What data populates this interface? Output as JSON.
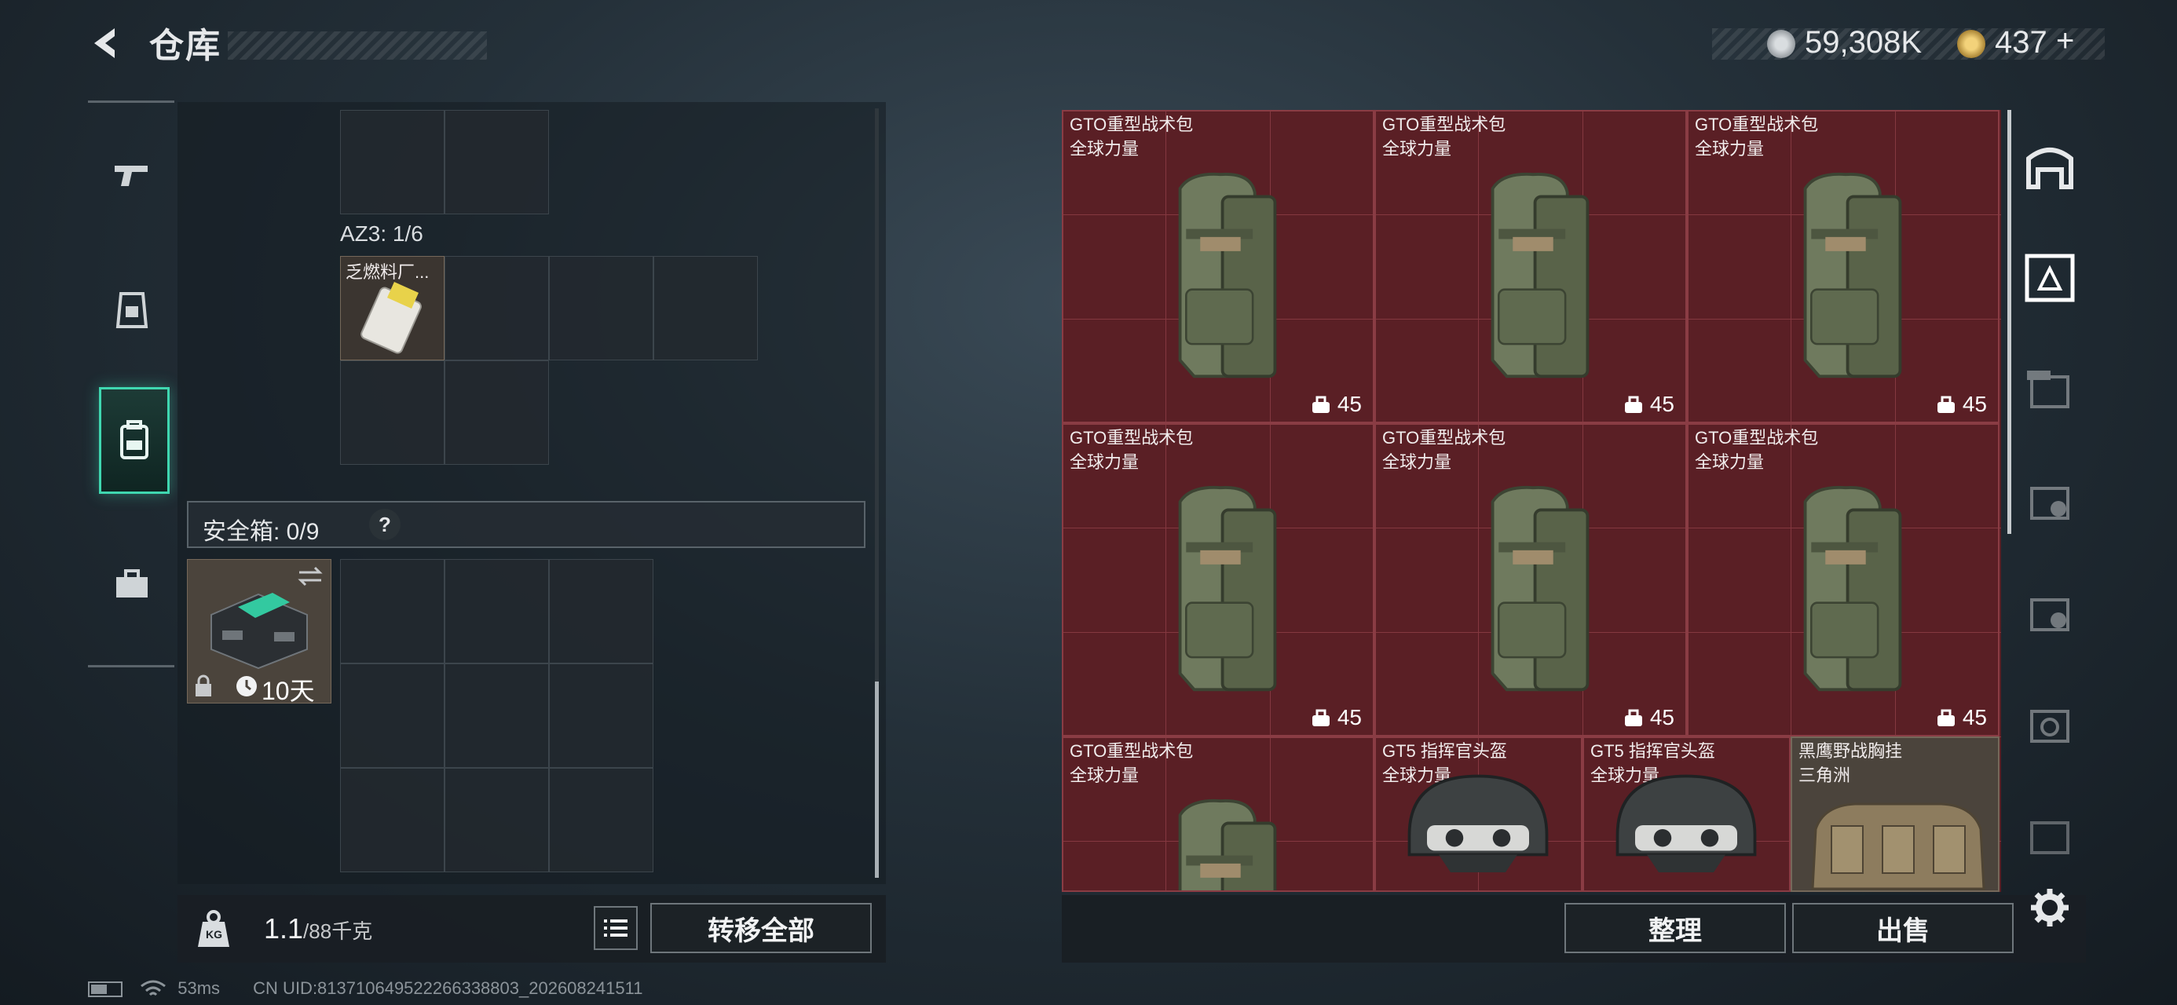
{
  "header": {
    "title": "仓库",
    "currency_amount": "59,308K",
    "premium_amount": "437",
    "premium_plus": "+"
  },
  "inventory": {
    "az3_label": "AZ3: 1/6",
    "fuel_item_label": "乏燃料厂...",
    "safebox_label": "安全箱: 0/9",
    "safebox_help": "?",
    "safebox_time": "10天"
  },
  "bottom_left": {
    "weight_value": "1.1",
    "weight_max": "/88千克",
    "kg_label": "KG",
    "transfer_all": "转移全部"
  },
  "stash": {
    "items": [
      {
        "name": "GTO重型战术包",
        "sub": "全球力量",
        "count": "45"
      },
      {
        "name": "GTO重型战术包",
        "sub": "全球力量",
        "count": "45"
      },
      {
        "name": "GTO重型战术包",
        "sub": "全球力量",
        "count": "45"
      },
      {
        "name": "GTO重型战术包",
        "sub": "全球力量",
        "count": "45"
      },
      {
        "name": "GTO重型战术包",
        "sub": "全球力量",
        "count": "45"
      },
      {
        "name": "GTO重型战术包",
        "sub": "全球力量",
        "count": "45"
      },
      {
        "name": "GTO重型战术包",
        "sub": "全球力量"
      },
      {
        "name": "GT5 指挥官头盔",
        "sub": "全球力量"
      },
      {
        "name": "GT5 指挥官头盔",
        "sub": "全球力量"
      },
      {
        "name": "黑鹰野战胸挂",
        "sub": "三角洲"
      }
    ],
    "sort_button": "整理",
    "sell_button": "出售"
  },
  "footer": {
    "ping": "53ms",
    "uid": "CN UID:813710649522266338803_202608241511"
  },
  "icons": {
    "back": "back-arrow-icon",
    "silver_coin": "silver-coin-icon",
    "gold_coin": "gold-coin-icon",
    "settings": "gear-icon"
  },
  "colors": {
    "accent": "#3fd7b0",
    "stash_bg": "#5a1f25",
    "card_highlight": "#4b443c"
  }
}
